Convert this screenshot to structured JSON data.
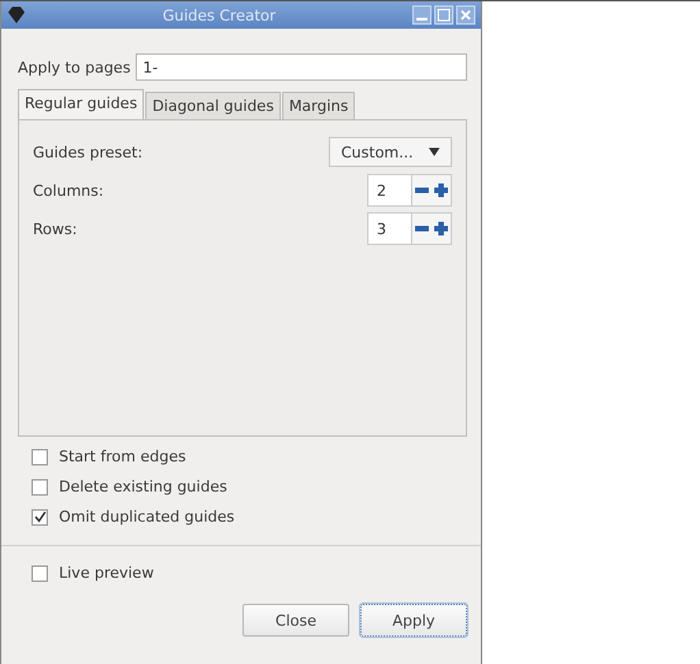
{
  "window": {
    "title": "Guides Creator"
  },
  "apply_to_pages": {
    "label": "Apply to pages",
    "value": "1-"
  },
  "tabs": [
    {
      "label": "Regular guides",
      "selected": true
    },
    {
      "label": "Diagonal guides",
      "selected": false
    },
    {
      "label": "Margins",
      "selected": false
    }
  ],
  "preset": {
    "label": "Guides preset:",
    "value": "Custom..."
  },
  "spinners": [
    {
      "label": "Columns:",
      "value": "2"
    },
    {
      "label": "Rows:",
      "value": "3"
    }
  ],
  "options": [
    {
      "label": "Start from edges",
      "checked": false
    },
    {
      "label": "Delete existing guides",
      "checked": false
    },
    {
      "label": "Omit duplicated guides",
      "checked": true
    }
  ],
  "live_preview": {
    "label": "Live preview",
    "checked": false
  },
  "buttons": [
    {
      "label": "Close",
      "kind": "normal"
    },
    {
      "label": "Apply",
      "kind": "default"
    }
  ]
}
